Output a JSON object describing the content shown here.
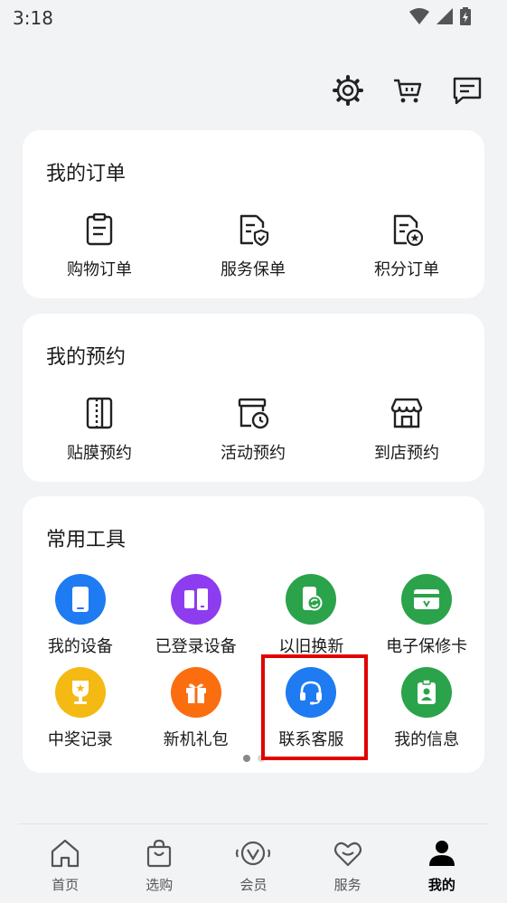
{
  "status_bar": {
    "time": "3:18",
    "icons": [
      "wifi-icon",
      "signal-icon",
      "battery-charging-icon"
    ]
  },
  "top_actions": [
    {
      "name": "settings-button",
      "icon": "gear-icon"
    },
    {
      "name": "cart-button",
      "icon": "cart-icon"
    },
    {
      "name": "messages-button",
      "icon": "message-icon"
    }
  ],
  "orders": {
    "title": "我的订单",
    "items": [
      {
        "label": "购物订单",
        "icon": "clipboard-icon"
      },
      {
        "label": "服务保单",
        "icon": "shield-document-icon"
      },
      {
        "label": "积分订单",
        "icon": "star-document-icon"
      }
    ]
  },
  "reservations": {
    "title": "我的预约",
    "items": [
      {
        "label": "贴膜预约",
        "icon": "phone-film-icon"
      },
      {
        "label": "活动预约",
        "icon": "calendar-clock-icon"
      },
      {
        "label": "到店预约",
        "icon": "store-icon"
      }
    ]
  },
  "tools": {
    "title": "常用工具",
    "rows": [
      [
        {
          "label": "我的设备",
          "icon": "device-icon",
          "color": "#1e7bf2"
        },
        {
          "label": "已登录设备",
          "icon": "devices-icon",
          "color": "#8e3cf0"
        },
        {
          "label": "以旧换新",
          "icon": "phone-exchange-icon",
          "color": "#2aa34a"
        },
        {
          "label": "电子保修卡",
          "icon": "warranty-card-icon",
          "color": "#2aa34a"
        }
      ],
      [
        {
          "label": "中奖记录",
          "icon": "trophy-icon",
          "color": "#f5b913"
        },
        {
          "label": "新机礼包",
          "icon": "gift-icon",
          "color": "#fa6e10"
        },
        {
          "label": "联系客服",
          "icon": "headset-icon",
          "color": "#1e7bf2"
        },
        {
          "label": "我的信息",
          "icon": "badge-icon",
          "color": "#2aa34a"
        }
      ]
    ],
    "page_dots": 2,
    "active_page": 0
  },
  "tabbar": {
    "tabs": [
      {
        "label": "首页",
        "icon": "home-icon"
      },
      {
        "label": "选购",
        "icon": "shopping-bag-icon"
      },
      {
        "label": "会员",
        "icon": "member-icon"
      },
      {
        "label": "服务",
        "icon": "heart-icon"
      },
      {
        "label": "我的",
        "icon": "person-icon"
      }
    ],
    "active": 4
  },
  "colors": {
    "background": "#f1f3f5",
    "card": "#ffffff",
    "highlight": "#e10000"
  }
}
